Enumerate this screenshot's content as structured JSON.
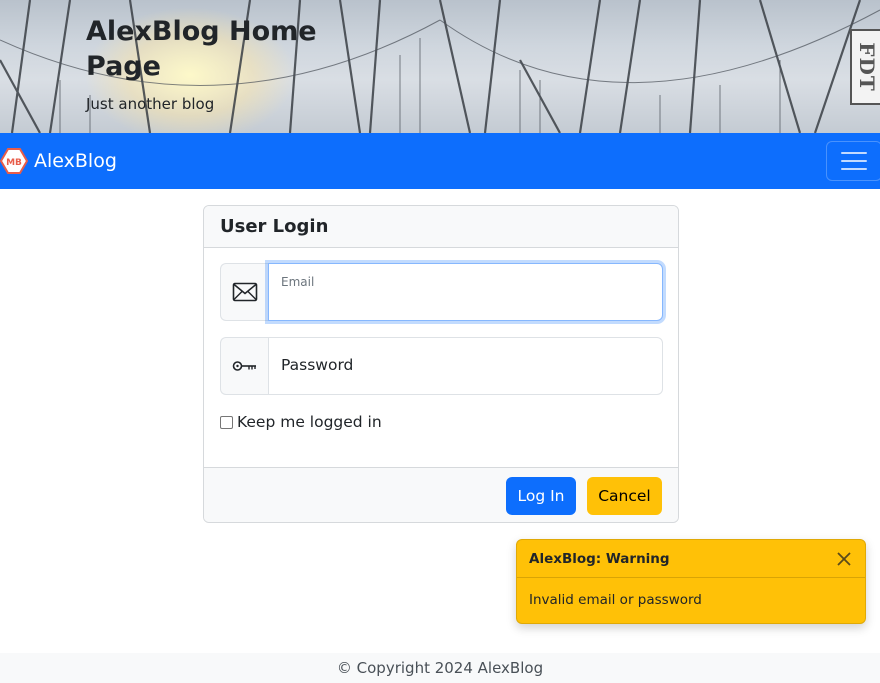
{
  "header": {
    "title": "AlexBlog Home Page",
    "tagline": "Just another blog",
    "badge_text": "FDT"
  },
  "navbar": {
    "brand_logo_text": "MB",
    "brand_name": "AlexBlog",
    "toggler_icon": "hamburger-menu-icon",
    "color": "#0d6efd"
  },
  "login": {
    "title": "User Login",
    "email_label": "Email",
    "email_icon": "envelope-icon",
    "password_label": "Password",
    "password_icon": "key-icon",
    "remember_label": "Keep me logged in",
    "remember_checked": false,
    "login_button": "Log In",
    "cancel_button": "Cancel"
  },
  "toast": {
    "title": "AlexBlog: Warning",
    "message": "Invalid email or password",
    "color": "#ffc107",
    "close_icon": "close-icon"
  },
  "footer": {
    "copyright": "© Copyright 2024 AlexBlog"
  }
}
